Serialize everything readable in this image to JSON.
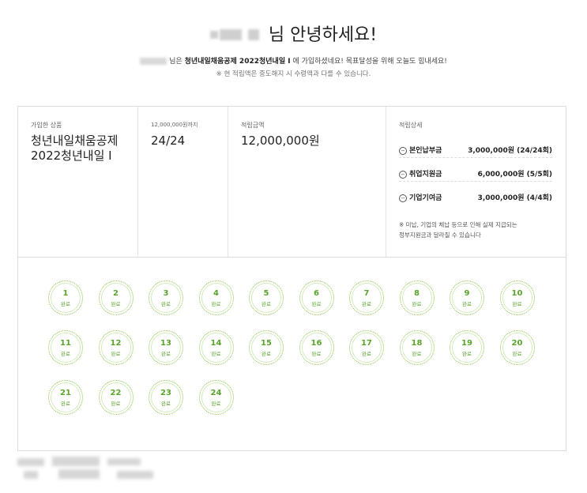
{
  "greeting": {
    "suffix": "님 안녕하세요!"
  },
  "intro": {
    "prefix": "님은 ",
    "product": "청년내일채움공제 2022청년내일 I",
    "rest": " 에 가입하셨네요! 목표달성을 위해 오늘도 힘내세요!",
    "note": "※ 현 적립액은 중도해지 시 수령액과 다를 수 있습니다."
  },
  "summary": {
    "product_label": "가입한 상품",
    "product_name_line1": "청년내일채움공제",
    "product_name_line2": "2022청년내일 I",
    "progress_label": "12,000,000원까지",
    "progress_value": "24/24",
    "amount_label": "적립금액",
    "amount_value": "12,000,000원"
  },
  "details": {
    "label": "적립상세",
    "rows": [
      {
        "name": "본인납부금",
        "amount": "3,000,000원 (24/24회)"
      },
      {
        "name": "취업지원금",
        "amount": "6,000,000원 (5/5회)"
      },
      {
        "name": "기업기여금",
        "amount": "3,000,000원 (4/4회)"
      }
    ],
    "note_line1": "※ 미납, 기업의 체납 등으로 인해 실제 지급되는",
    "note_line2": "정부지원금과 달라질 수 있습니다"
  },
  "stamps": {
    "status": "완료",
    "numbers": [
      "1",
      "2",
      "3",
      "4",
      "5",
      "6",
      "7",
      "8",
      "9",
      "10",
      "11",
      "12",
      "13",
      "14",
      "15",
      "16",
      "17",
      "18",
      "19",
      "20",
      "21",
      "22",
      "23",
      "24"
    ]
  },
  "colors": {
    "stamp_green": "#5aa52c",
    "border": "#dddddd"
  }
}
